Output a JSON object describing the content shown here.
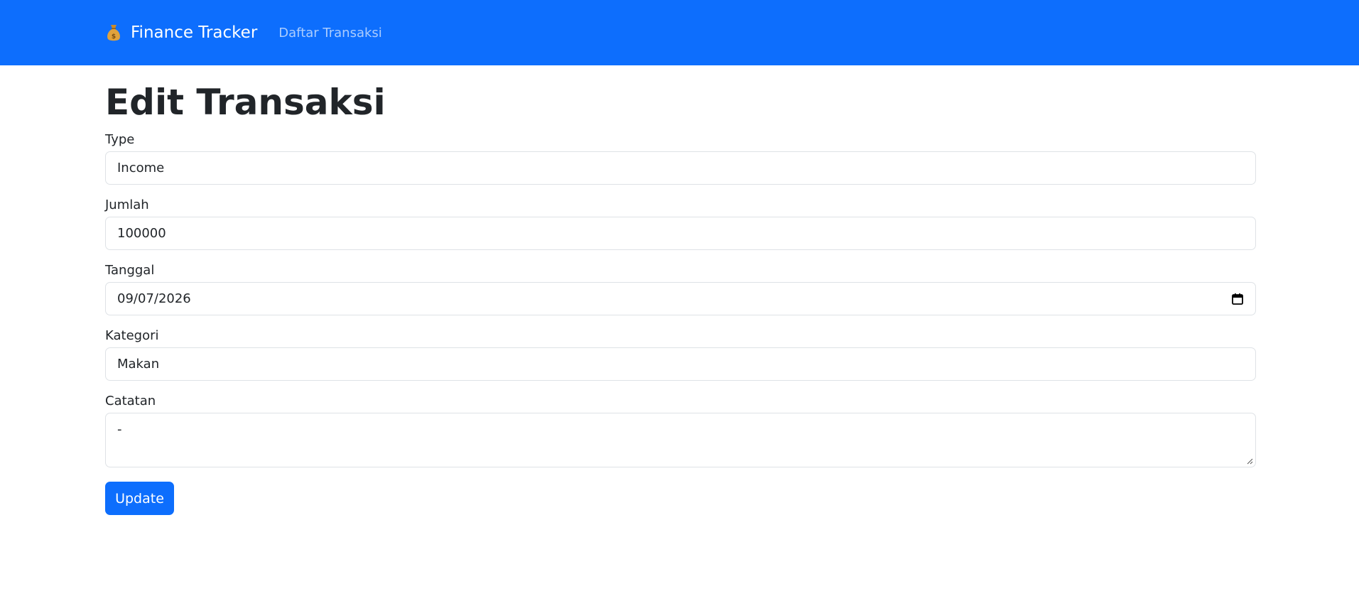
{
  "nav": {
    "brand": "Finance Tracker",
    "link": "Daftar Transaksi",
    "brand_icon": "money-bag-icon"
  },
  "page": {
    "title": "Edit Transaksi"
  },
  "form": {
    "type": {
      "label": "Type",
      "value": "Income"
    },
    "jumlah": {
      "label": "Jumlah",
      "value": "100000"
    },
    "tanggal": {
      "label": "Tanggal",
      "value": "09/07/2026"
    },
    "kategori": {
      "label": "Kategori",
      "value": "Makan"
    },
    "catatan": {
      "label": "Catatan",
      "value": "-"
    },
    "submit_label": "Update"
  },
  "colors": {
    "primary": "#0d6efd",
    "border": "#dee2e6",
    "text": "#212529"
  }
}
